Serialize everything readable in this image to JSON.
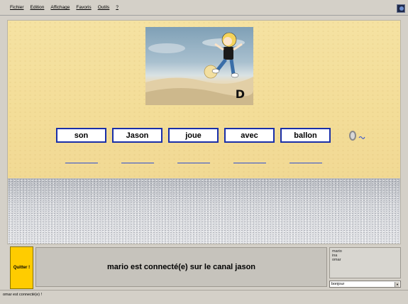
{
  "menu": {
    "items": [
      "Fichier",
      "Edition",
      "Affichage",
      "Favoris",
      "Outils",
      "?"
    ]
  },
  "picture": {
    "letter": "D"
  },
  "words": [
    "son",
    "Jason",
    "joue",
    "avec",
    "ballon"
  ],
  "answer_slots": 5,
  "panel": {
    "quit_label": "Quitter !",
    "message": "mario est connecté(e) sur le canal jason",
    "users": [
      "mario",
      "ina",
      "omar"
    ],
    "chat_value": "bonjour"
  },
  "status": {
    "text": "omar  est connecté(e) !"
  },
  "colors": {
    "card_border": "#1a2fa8",
    "quit_button": "#ffcc00",
    "wall": "#f3dd98"
  }
}
